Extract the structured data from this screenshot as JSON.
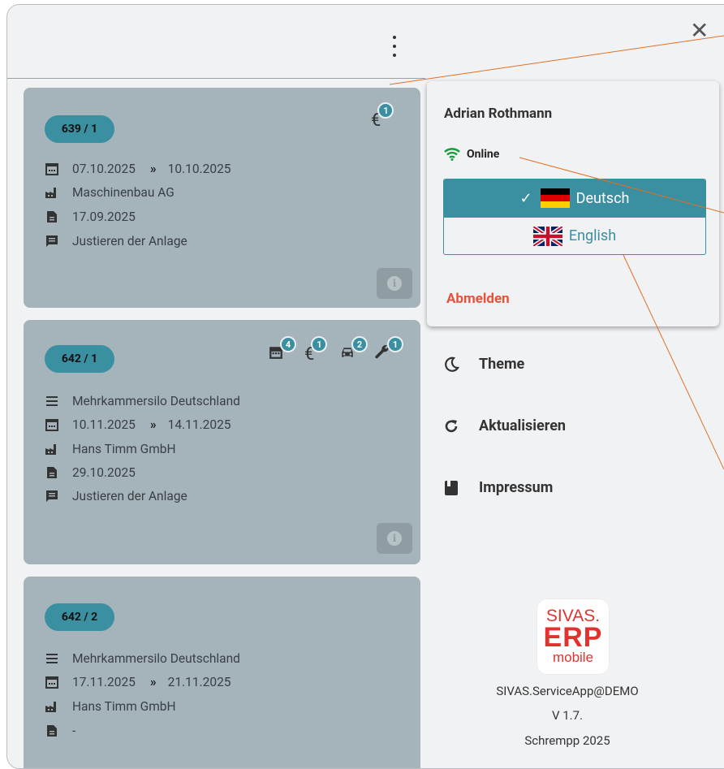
{
  "close_label": "✕",
  "colors": {
    "accent": "#3a8fa0",
    "card": "#a4b4ba",
    "logout": "#e5533d",
    "online": "#1a9a3d",
    "logo_red": "#e2322d"
  },
  "cards": [
    {
      "id": "639 / 1",
      "date_from": "07.10.2025",
      "arrow": "»",
      "date_to": "10.10.2025",
      "company": "Maschinenbau AG",
      "doc_date": "17.09.2025",
      "comment": "Justieren der Anlage",
      "stats": [
        {
          "icon": "euro-icon",
          "glyph": "€",
          "count": "1"
        }
      ]
    },
    {
      "id": "642 / 1",
      "project": "Mehrkammersilo Deutschland",
      "date_from": "10.11.2025",
      "arrow": "»",
      "date_to": "14.11.2025",
      "company": "Hans Timm GmbH",
      "doc_date": "29.10.2025",
      "comment": "Justieren der Anlage",
      "stats": [
        {
          "icon": "calendar-icon",
          "count": "4"
        },
        {
          "icon": "euro-icon",
          "glyph": "€",
          "count": "1"
        },
        {
          "icon": "car-icon",
          "count": "2"
        },
        {
          "icon": "wrench-icon",
          "count": "1"
        }
      ]
    },
    {
      "id": "642 / 2",
      "project": "Mehrkammersilo Deutschland",
      "date_from": "17.11.2025",
      "arrow": "»",
      "date_to": "21.11.2025",
      "company": "Hans Timm GmbH",
      "doc_date": "-"
    }
  ],
  "popup": {
    "user_name": "Adrian Rothmann",
    "status": "Online",
    "languages": [
      {
        "label": "Deutsch",
        "selected": true,
        "check": "✓"
      },
      {
        "label": "English",
        "selected": false
      }
    ],
    "logout": "Abmelden"
  },
  "menu": [
    {
      "icon": "moon-icon",
      "label": "Theme"
    },
    {
      "icon": "refresh-icon",
      "label": "Aktualisieren"
    },
    {
      "icon": "book-icon",
      "label": "Impressum"
    }
  ],
  "logo": {
    "line1": "SIVAS.",
    "line2": "ERP",
    "line3": "mobile"
  },
  "footer": {
    "app": "SIVAS.ServiceApp@DEMO",
    "version": "V 1.7.",
    "copyright": "Schrempp 2025"
  }
}
